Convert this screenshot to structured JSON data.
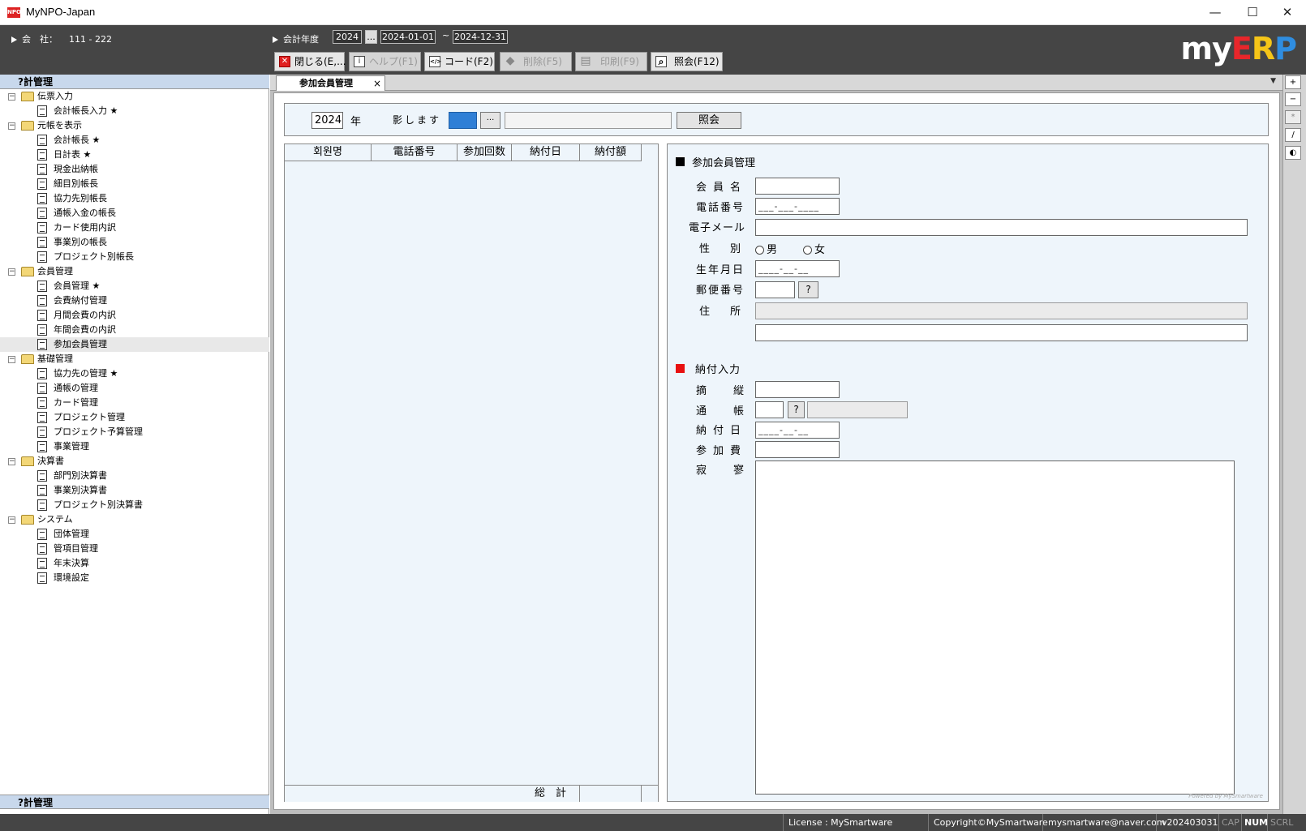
{
  "window": {
    "title": "MyNPO-Japan",
    "app_icon_text": "NPO",
    "minimize": "—",
    "maximize": "☐",
    "close": "✕"
  },
  "header": {
    "company_label": "会　社：",
    "company_value": "111 - 222",
    "fiscal_label": "会計年度",
    "fiscal_year": "2024",
    "ellipsis": "...",
    "date_from": "2024-01-01",
    "tilde": "~",
    "date_to": "2024-12-31",
    "logo": {
      "part1": "my",
      "part2": "E",
      "part3": "R",
      "part4": "P",
      "colors": {
        "my": "#ffffff",
        "E": "#e8262b",
        "R": "#f5c518",
        "P": "#2f8de0"
      }
    }
  },
  "toolbar": [
    {
      "name": "close-button",
      "label": "閉じる(E,...",
      "icon": "✕",
      "icon_color": "#e02020",
      "enabled": true
    },
    {
      "name": "help-button",
      "label": "ヘルプ(F1)",
      "icon": "i",
      "enabled": false
    },
    {
      "name": "code-button",
      "label": "コード(F2)",
      "icon": "</>",
      "enabled": true
    },
    {
      "name": "delete-button",
      "label": "削除(F5)",
      "icon": "◆",
      "enabled": false
    },
    {
      "name": "print-button",
      "label": "印刷(F9)",
      "icon": "▤",
      "enabled": false
    },
    {
      "name": "inquiry-button",
      "label": "照会(F12)",
      "icon": "⌕",
      "enabled": true
    }
  ],
  "sidebar": {
    "header": "?計管理",
    "footer": "?計管理",
    "groups": [
      {
        "label": "伝票入力",
        "toggle": "−",
        "items": [
          "会計帳長入力 ★"
        ]
      },
      {
        "label": "元帳を表示",
        "toggle": "−",
        "items": [
          "会計帳長 ★",
          "日計表 ★",
          "現金出納帳",
          "細目別帳長",
          "協力先別帳長",
          "通帳入金の帳長",
          "カード使用内訳",
          "事業別の帳長",
          "プロジェクト別帳長"
        ]
      },
      {
        "label": "会員管理",
        "toggle": "−",
        "items": [
          "会員管理 ★",
          "会費納付管理",
          "月間会費の内訳",
          "年間会費の内訳",
          "参加会員管理"
        ]
      },
      {
        "label": "基礎管理",
        "toggle": "−",
        "items": [
          "協力先の管理 ★",
          "通帳の管理",
          "カード管理",
          "プロジェクト管理",
          "プロジェクト予算管理",
          "事業管理"
        ]
      },
      {
        "label": "決算書",
        "toggle": "−",
        "items": [
          "部門別決算書",
          "事業別決算書",
          "プロジェクト別決算書"
        ]
      },
      {
        "label": "システム",
        "toggle": "−",
        "items": [
          "団体管理",
          "管項目管理",
          "年末決算",
          "環境設定"
        ]
      }
    ],
    "selected": "参加会員管理"
  },
  "tab": {
    "label": "参加会員管理",
    "close": "×",
    "dropdown": "▼"
  },
  "search": {
    "year": "2024",
    "year_label": "年",
    "filter_label": "影します",
    "dots": "···",
    "text": "",
    "button": "照会"
  },
  "list": {
    "columns": [
      "회원명",
      "電話番号",
      "参加回数",
      "納付日",
      "納付額"
    ],
    "rows": [],
    "total_label": "総　計"
  },
  "form": {
    "section1_title": "参加会員管理",
    "section1_marker_color": "#000000",
    "name_label": "会員名",
    "name_value": "",
    "phone_label": "電話番号",
    "phone_value": "___-___-____",
    "email_label": "電子メール",
    "email_value": "",
    "gender_label": "性　別",
    "gender_male": "男",
    "gender_female": "女",
    "birth_label": "生年月日",
    "birth_value": "____-__-__",
    "zip_label": "郵便番号",
    "zip_value": "",
    "zip_button": "?",
    "address_label": "住　所",
    "address1": "",
    "address2": "",
    "section2_title": "納付入力",
    "section2_marker_color": "#e81010",
    "summary_label": "摘　縦",
    "summary_value": "",
    "account_label": "通　帳",
    "account_code": "",
    "account_button": "?",
    "account_name": "",
    "paydate_label": "納付日",
    "paydate_value": "____-__-__",
    "fee_label": "参加費",
    "fee_value": "",
    "memo_label": "寂　寥",
    "memo_value": "",
    "powered": "Powered by MySmartware"
  },
  "rightbar": [
    "+",
    "−",
    "*",
    "/",
    "◐"
  ],
  "status": {
    "license": "License : MySmartware",
    "copyright": "Copyright©MySmartware",
    "email": "mysmartware@naver.com",
    "version": "v202403031",
    "cap": "CAP",
    "num": "NUM",
    "scrl": "SCRL"
  }
}
